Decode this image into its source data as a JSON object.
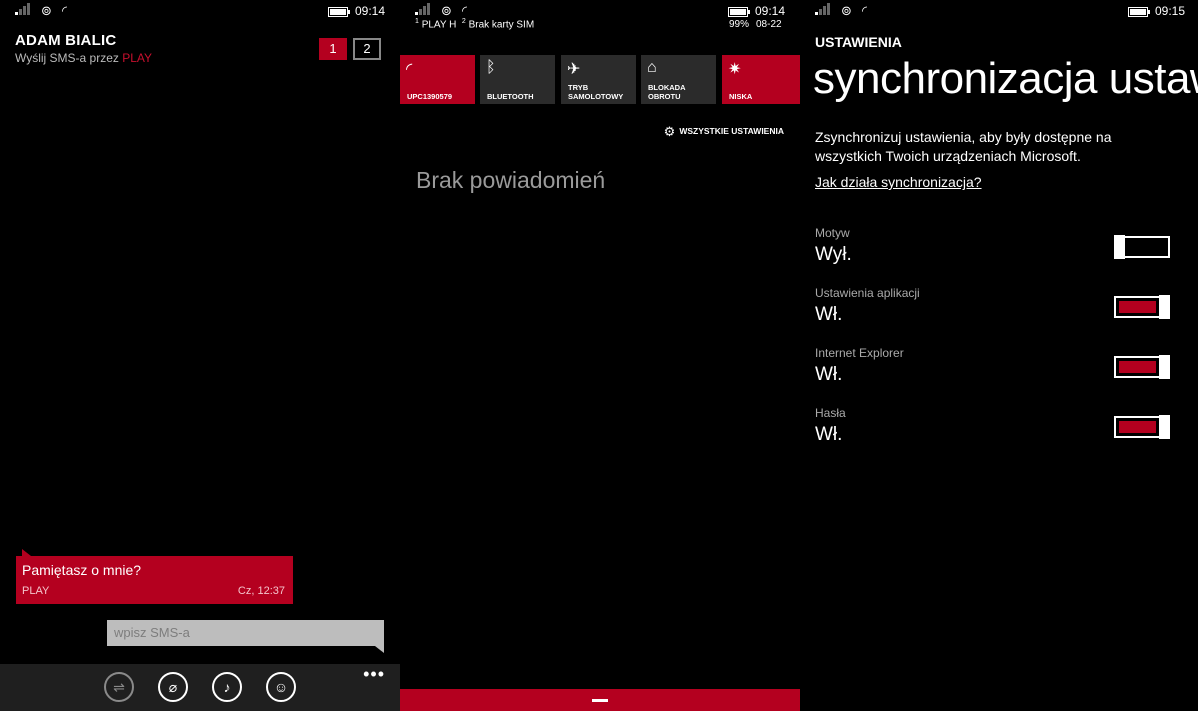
{
  "colors": {
    "accent": "#b4001f",
    "background": "#000000"
  },
  "screen1": {
    "status": {
      "time": "09:14"
    },
    "contact_name": "ADAM BIALIC",
    "send_via": "Wyślij SMS-a przez",
    "carrier": "PLAY",
    "sim_tabs": [
      "1",
      "2"
    ],
    "message": {
      "text": "Pamiętasz o mnie?",
      "sender": "PLAY",
      "time": "Cz, 12:37"
    },
    "input_placeholder": "wpisz SMS-a",
    "appbar_icons": [
      "switch-sim-icon",
      "attach-icon",
      "microphone-icon",
      "contact-card-icon"
    ],
    "more": "•••"
  },
  "screen2": {
    "status": {
      "time": "09:14",
      "battery": "99%",
      "date": "08-22",
      "sim1_num": "1",
      "sim1": "PLAY H",
      "sim2_num": "2",
      "sim2": "Brak karty SIM"
    },
    "tiles": [
      {
        "label": "UPC1390579",
        "icon": "wifi-icon",
        "on": true
      },
      {
        "label": "BLUETOOTH",
        "icon": "bluetooth-icon",
        "on": false
      },
      {
        "label": "TRYB SAMOLOTOWY",
        "icon": "airplane-icon",
        "on": false
      },
      {
        "label": "BLOKADA OBROTU",
        "icon": "rotation-lock-icon",
        "on": false
      },
      {
        "label": "NISKA",
        "icon": "brightness-icon",
        "on": true
      }
    ],
    "all_settings": "WSZYSTKIE USTAWIENIA",
    "empty": "Brak powiadomień"
  },
  "screen3": {
    "status": {
      "time": "09:15"
    },
    "section": "USTAWIENIA",
    "title": "synchronizacja ustawień",
    "description": "Zsynchronizuj ustawienia, aby były dostępne na wszystkich Twoich urządzeniach Microsoft.",
    "help_link": "Jak działa synchronizacja?",
    "settings": [
      {
        "label": "Motyw",
        "value": "Wył.",
        "on": false
      },
      {
        "label": "Ustawienia aplikacji",
        "value": "Wł.",
        "on": true
      },
      {
        "label": "Internet Explorer",
        "value": "Wł.",
        "on": true
      },
      {
        "label": "Hasła",
        "value": "Wł.",
        "on": true
      }
    ]
  }
}
